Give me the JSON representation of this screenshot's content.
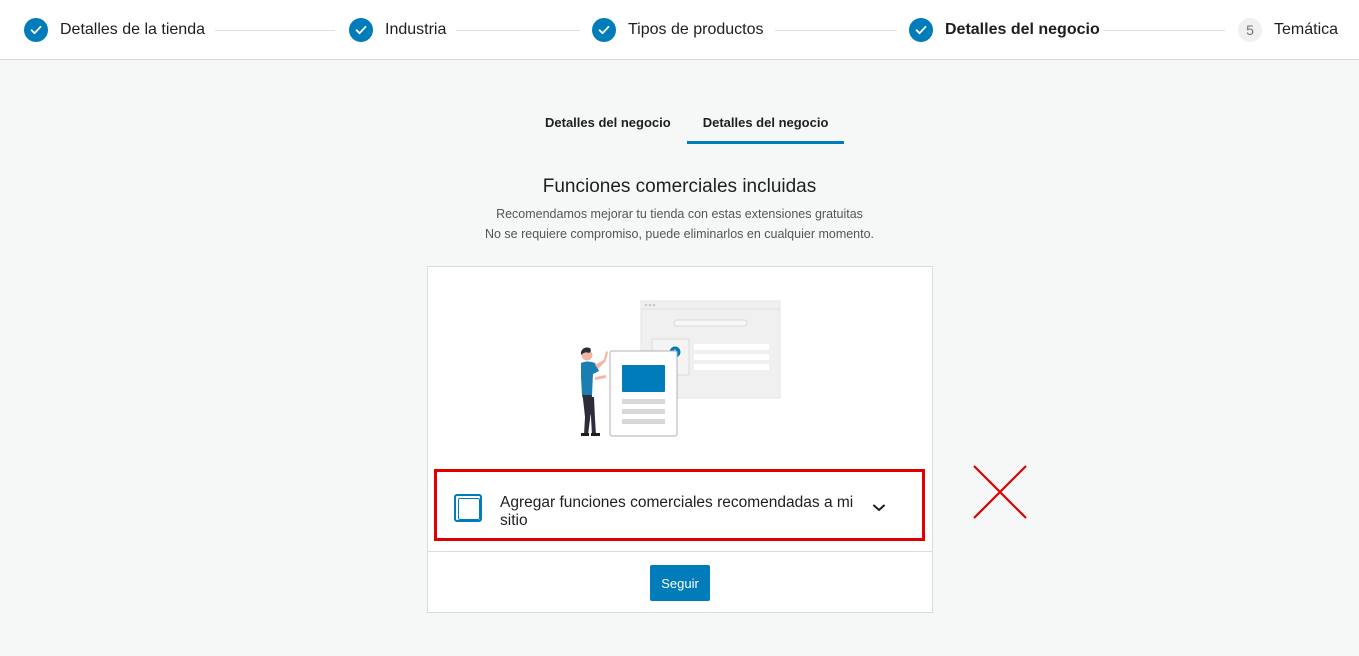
{
  "stepper": {
    "steps": [
      {
        "label": "Detalles de la tienda",
        "state": "done"
      },
      {
        "label": "Industria",
        "state": "done"
      },
      {
        "label": "Tipos de productos",
        "state": "done"
      },
      {
        "label": "Detalles del negocio",
        "state": "done-active"
      },
      {
        "label": "Temática",
        "state": "todo",
        "number": "5"
      }
    ]
  },
  "tabs": [
    {
      "label": "Detalles del negocio",
      "active": false
    },
    {
      "label": "Detalles del negocio",
      "active": true
    }
  ],
  "main": {
    "title": "Funciones comerciales incluidas",
    "subtitle_line1": "Recomendamos mejorar tu tienda con estas extensiones gratuitas",
    "subtitle_line2": "No se requiere compromiso, puede eliminarlos en cualquier momento."
  },
  "card": {
    "feature_label": "Agregar funciones comerciales recomendadas a mi sitio",
    "feature_checked": false,
    "continue_label": "Seguir"
  },
  "colors": {
    "accent": "#007cba",
    "annotation": "#e00000"
  }
}
